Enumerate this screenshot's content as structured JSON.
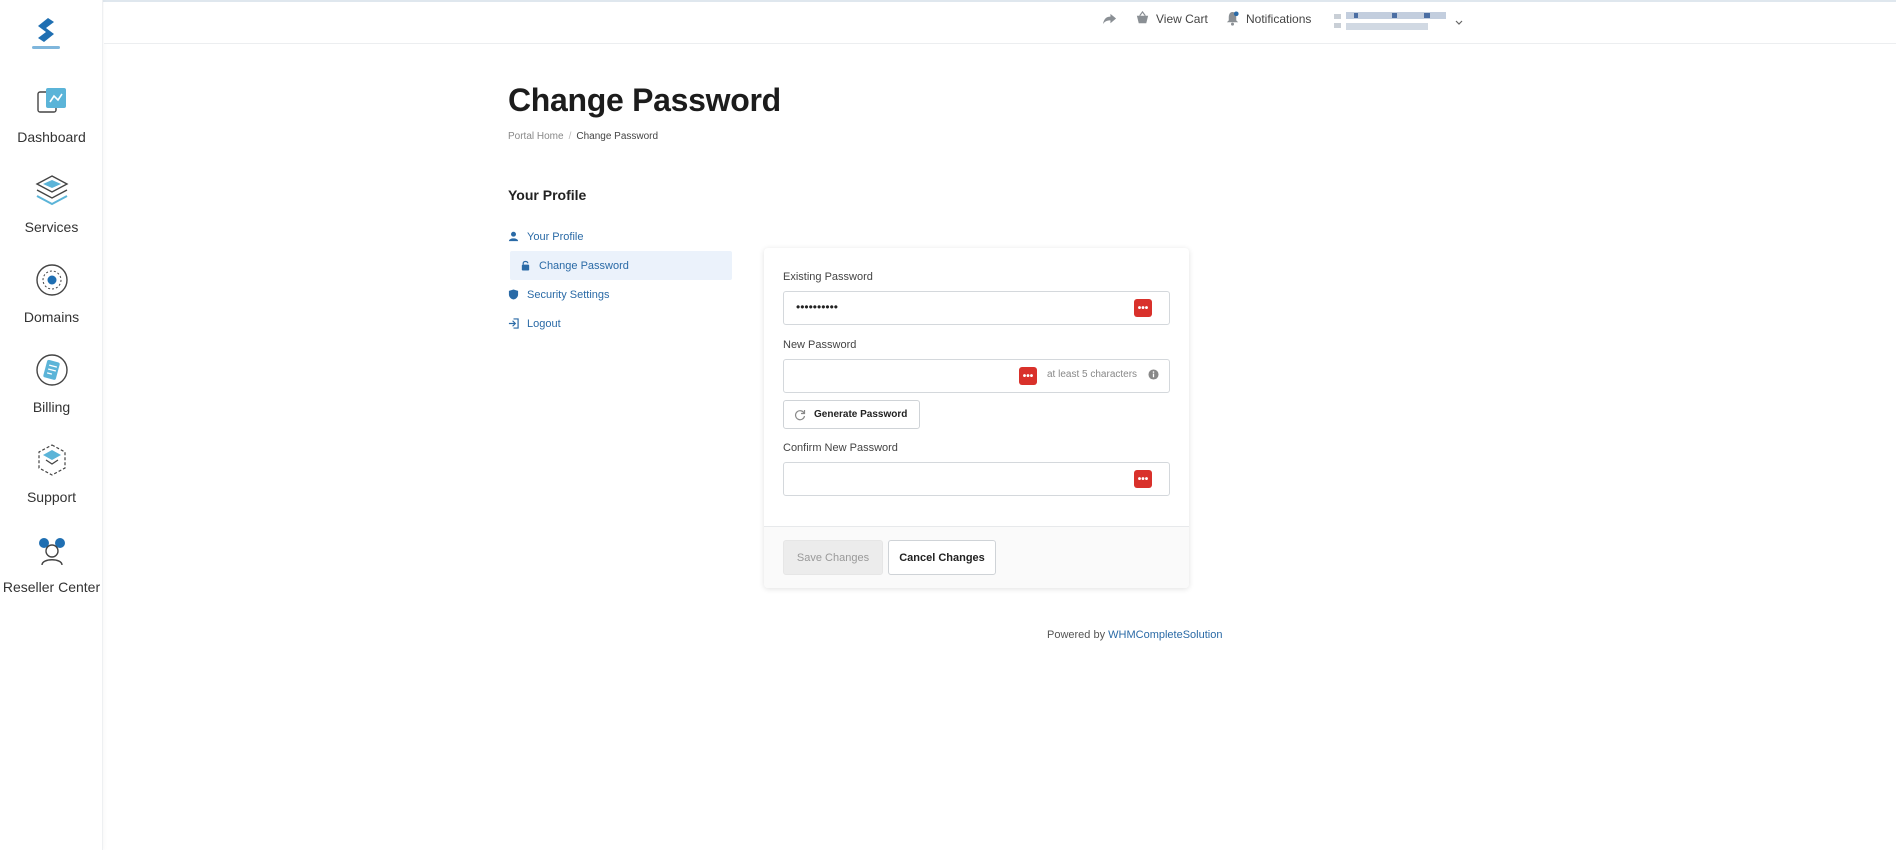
{
  "header": {
    "view_cart": "View Cart",
    "notifications": "Notifications"
  },
  "sidebar": {
    "items": [
      {
        "label": "Dashboard",
        "icon": "dashboard-icon"
      },
      {
        "label": "Services",
        "icon": "services-icon"
      },
      {
        "label": "Domains",
        "icon": "domains-icon"
      },
      {
        "label": "Billing",
        "icon": "billing-icon"
      },
      {
        "label": "Support",
        "icon": "support-icon"
      },
      {
        "label": "Reseller Center",
        "icon": "reseller-icon"
      }
    ]
  },
  "page": {
    "title": "Change Password",
    "breadcrumb": [
      "Portal Home",
      "Change Password"
    ]
  },
  "profile_menu": {
    "title": "Your Profile",
    "items": [
      "Your Profile",
      "Change Password",
      "Security Settings",
      "Logout"
    ],
    "active": "Change Password"
  },
  "form": {
    "existing_label": "Existing Password",
    "existing_value": "••••••••••",
    "new_label": "New Password",
    "new_hint": "at least 5 characters",
    "generate_label": "Generate Password",
    "confirm_label": "Confirm New Password",
    "save_label": "Save Changes",
    "cancel_label": "Cancel Changes"
  },
  "footer": {
    "powered_by": "Powered by",
    "powered_link": "WHMCompleteSolution"
  },
  "colors": {
    "accent": "#2a6aa6",
    "active_bg": "#ebf2fb",
    "password_button": "#d9312b"
  }
}
